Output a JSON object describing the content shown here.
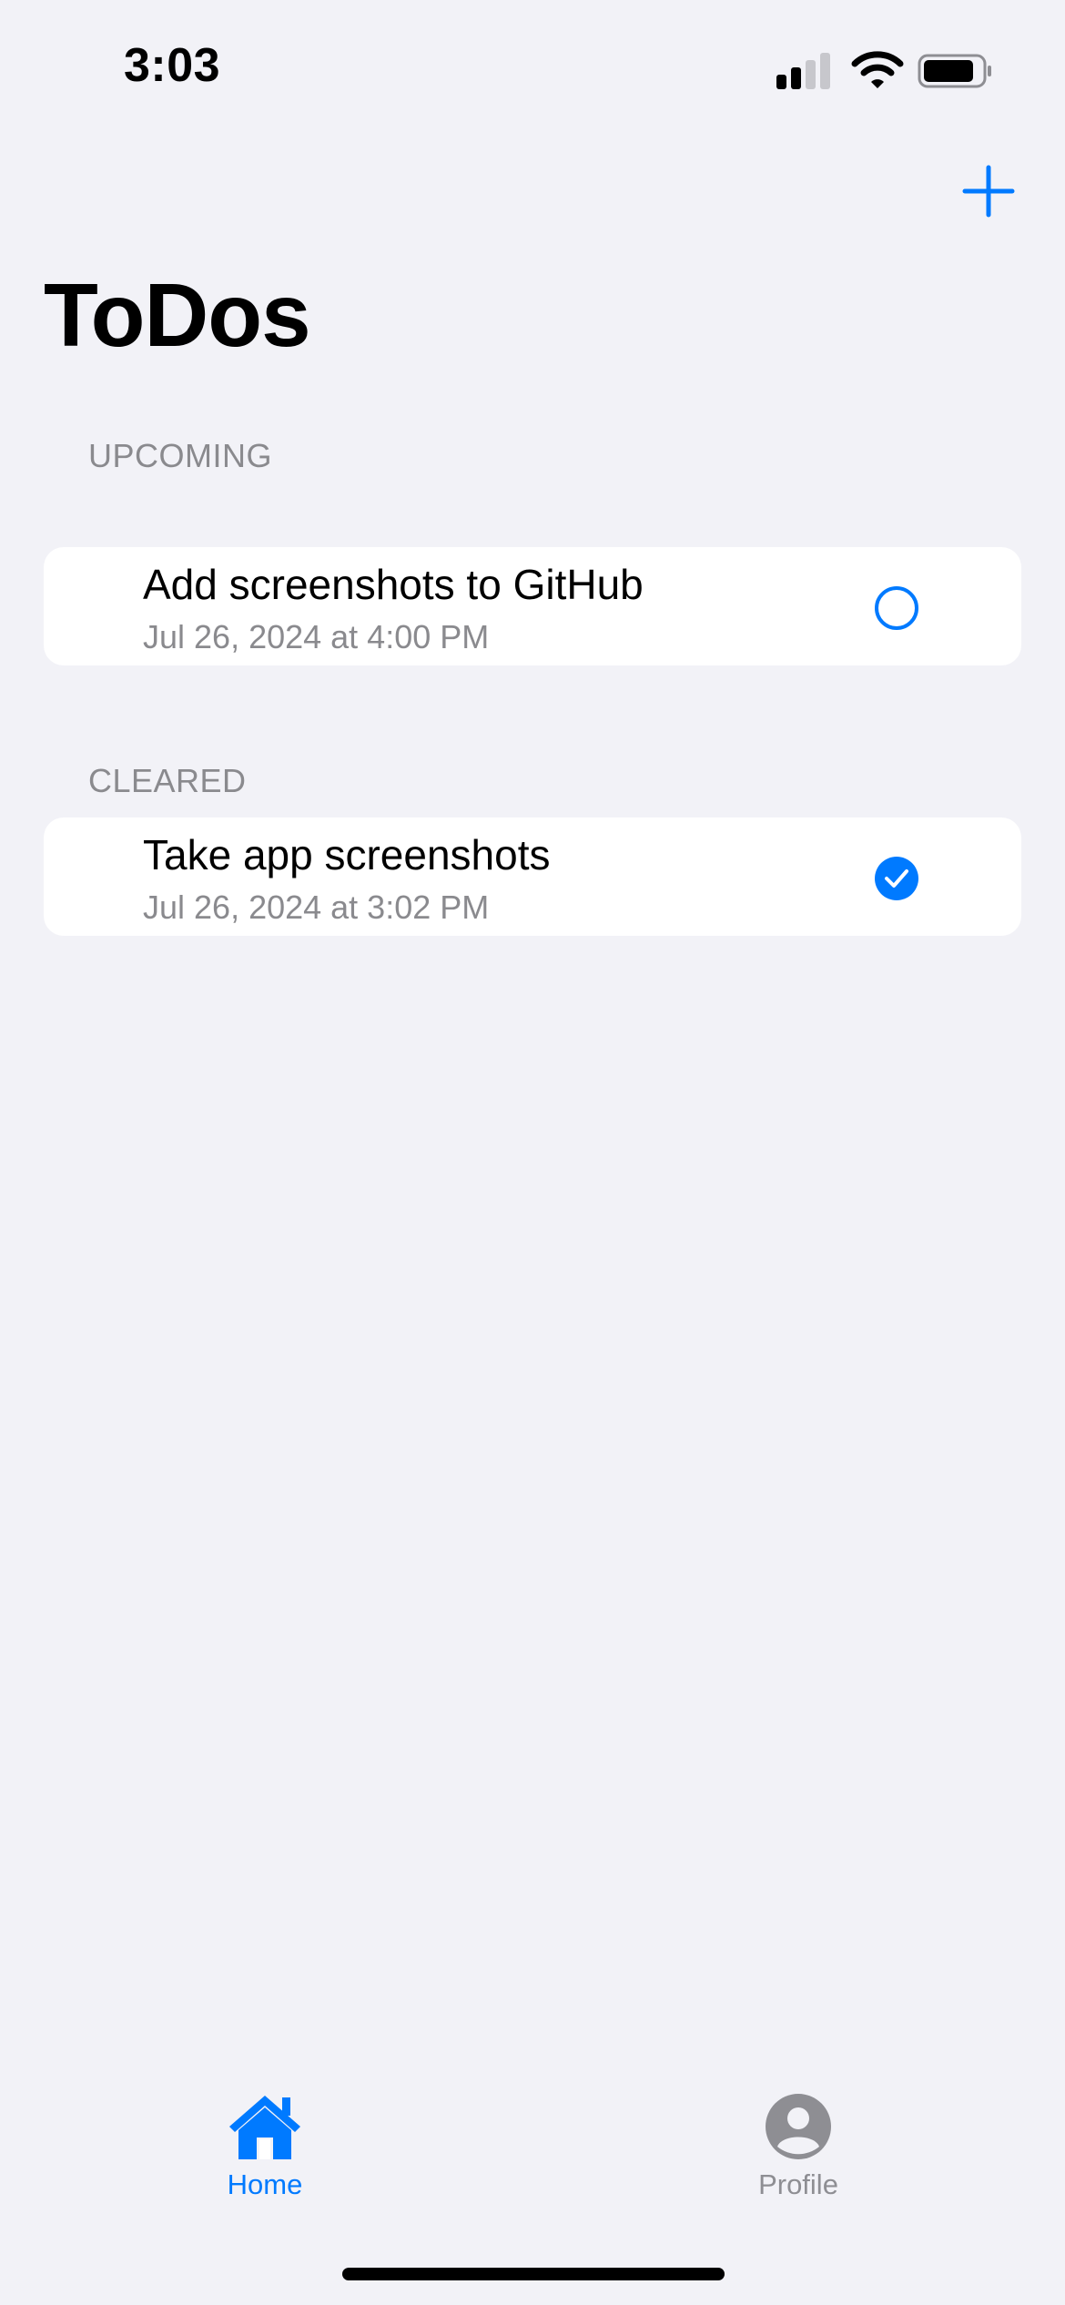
{
  "status_bar": {
    "time": "3:03"
  },
  "nav": {
    "add_icon": "plus-icon",
    "title": "ToDos"
  },
  "sections": {
    "upcoming": {
      "header": "UPCOMING",
      "items": [
        {
          "title": "Add screenshots to GitHub",
          "date": "Jul 26, 2024 at 4:00 PM",
          "completed": false
        }
      ]
    },
    "cleared": {
      "header": "CLEARED",
      "items": [
        {
          "title": "Take app screenshots",
          "date": "Jul 26, 2024 at 3:02 PM",
          "completed": true
        }
      ]
    }
  },
  "tab_bar": {
    "tabs": [
      {
        "label": "Home",
        "icon": "house-icon",
        "selected": true
      },
      {
        "label": "Profile",
        "icon": "person-circle-icon",
        "selected": false
      }
    ]
  },
  "colors": {
    "accent": "#007AFF",
    "background": "#F2F2F7",
    "secondary_text": "#8A8A8E",
    "inactive_tab": "#8E8E93"
  }
}
